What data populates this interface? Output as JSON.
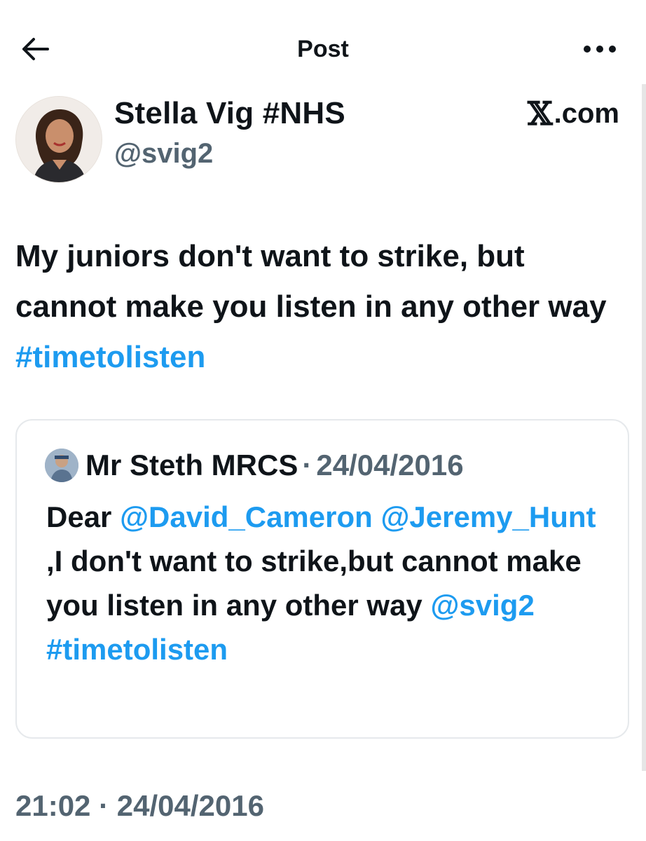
{
  "header": {
    "title": "Post",
    "back_icon": "arrow-left-icon",
    "more_icon": "more-horizontal-icon"
  },
  "author": {
    "display_name": "Stella Vig #NHS",
    "handle": "@svig2",
    "source": ".com",
    "source_logo": "𝕏"
  },
  "post": {
    "text_plain": "My juniors don't want to strike, but cannot make you listen in any other way ",
    "hashtag": "#timetolisten"
  },
  "quote": {
    "author_name": "Mr Steth MRCS",
    "separator": "·",
    "date": "24/04/2016",
    "text_part1": "Dear ",
    "mention1": "@David_Cameron",
    "mention2": "@Jeremy_Hunt",
    "text_part2": " ,I don't want to strike,but cannot make you listen in any other way ",
    "mention3": "@svig2",
    "hashtag": "#timetolisten"
  },
  "meta": {
    "time": "21:02",
    "separator": "·",
    "date": "24/04/2016"
  },
  "colors": {
    "link": "#1d9bf0",
    "secondary_text": "#536471",
    "primary_text": "#0f1419",
    "border": "#e6e9ec"
  }
}
